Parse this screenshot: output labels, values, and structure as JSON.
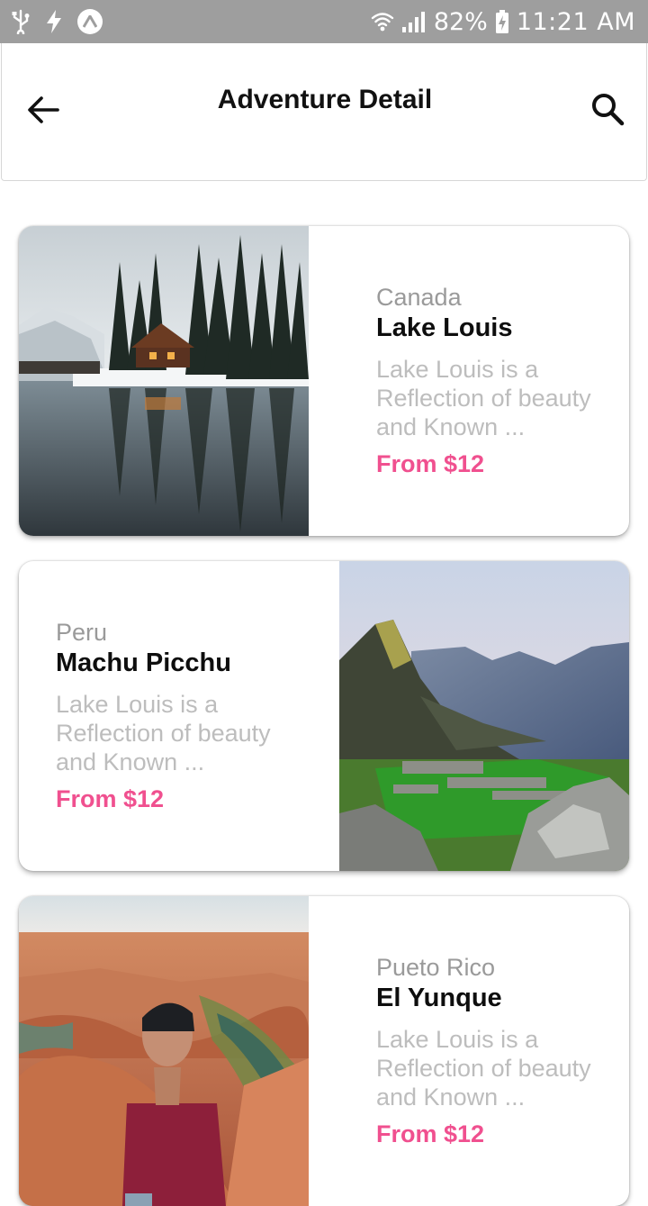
{
  "status_bar": {
    "battery_percent": "82%",
    "time": "11:21 AM",
    "icons": [
      "usb-icon",
      "flash-icon",
      "a-app-icon",
      "wifi-icon",
      "signal-icon",
      "battery-charging-icon"
    ]
  },
  "header": {
    "title": "Adventure Detail",
    "back_icon": "arrow-back-icon",
    "search_icon": "search-icon"
  },
  "cards": [
    {
      "country": "Canada",
      "place": "Lake Louis",
      "description_lines": [
        "Lake Louis is a",
        "Reflection of beauty",
        "and Known ..."
      ],
      "price": "From $12",
      "image": "snowy-cabin-lake-photo"
    },
    {
      "country": "Peru",
      "place": "Machu Picchu",
      "description_lines": [
        "Lake Louis is a",
        "Reflection of beauty",
        "and Known ..."
      ],
      "price": "From $12",
      "image": "machu-picchu-mountains-photo"
    },
    {
      "country": "Pueto Rico",
      "place": "El Yunque",
      "description_lines": [
        "Lake Louis is a",
        "Reflection of beauty",
        "and Known ..."
      ],
      "price": "From $12",
      "image": "canyon-man-sitting-photo"
    }
  ],
  "colors": {
    "status_bar": "#9e9e9e",
    "price": "#f0508f",
    "country": "#9a9a9a",
    "description": "#bdbdbd"
  }
}
